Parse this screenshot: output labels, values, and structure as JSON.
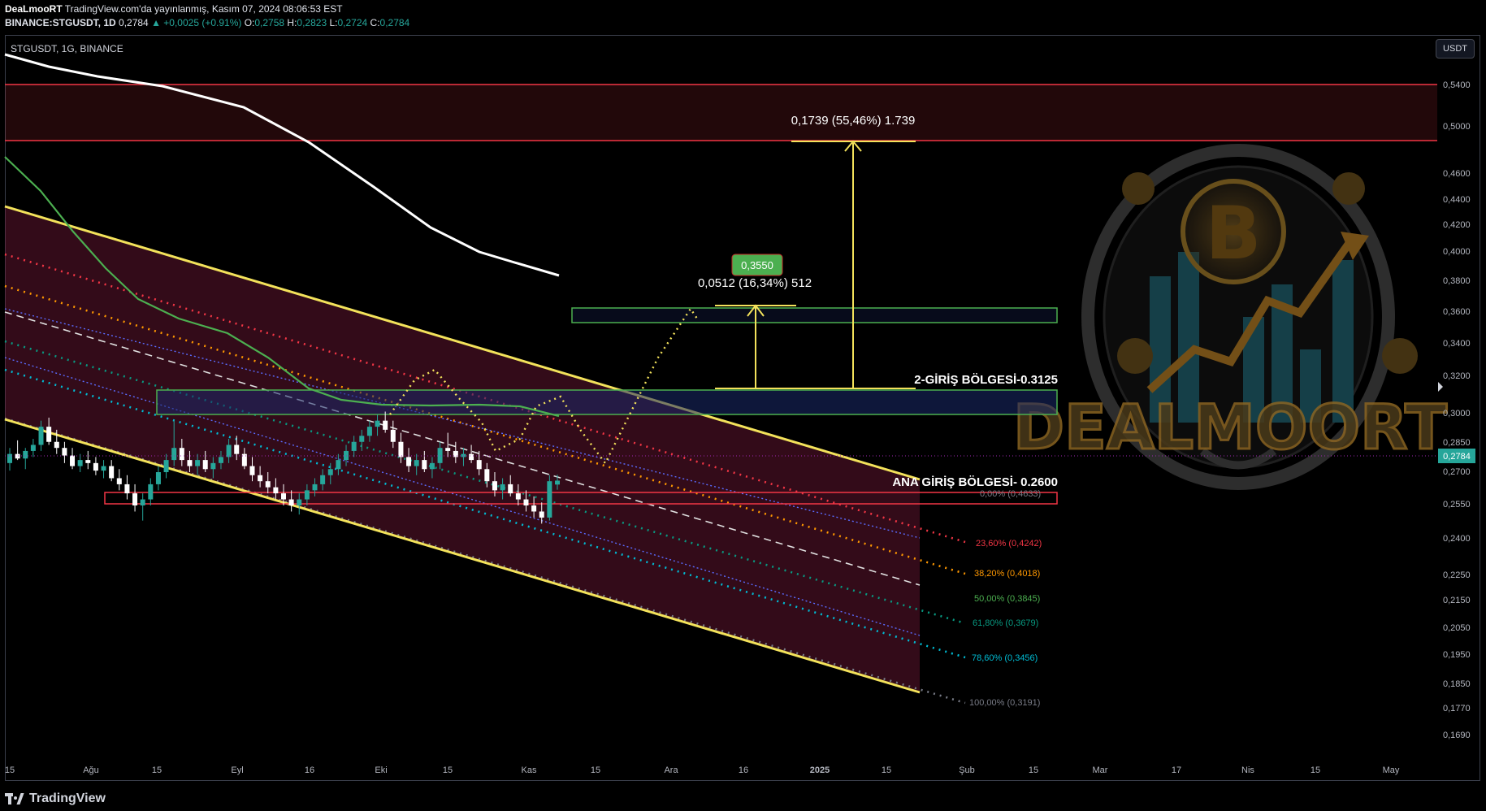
{
  "header": {
    "publisher": "DeaLmooRT",
    "published_text": "TradingView.com'da yayınlanmış, Kasım 07, 2024 08:06:53 EST",
    "symbol_line": "BINANCE:STGUSDT, 1D",
    "last": "0,2784",
    "change": "▲ +0,0025 (+0.91%)",
    "o_label": "O:",
    "o": "0,2758",
    "h_label": "H:",
    "h": "0,2823",
    "l_label": "L:",
    "l": "0,2724",
    "c_label": "C:",
    "c": "0,2784"
  },
  "pane_label": "STGUSDT, 1G, BINANCE",
  "currency_button": "USDT",
  "footer_logo": "TradingView",
  "watermark": "DEALMOORT",
  "colors": {
    "up": "#26a69a",
    "down": "#ffffff",
    "channel": "#f3e25b",
    "zone_red": "#f23645",
    "zone_green": "#4caf50"
  },
  "chart_data": {
    "type": "candlestick",
    "symbol": "STGUSDT",
    "timeframe": "1G",
    "y_axis_ticks": [
      "0,5400",
      "0,5000",
      "0,4600",
      "0,4400",
      "0,4200",
      "0,4000",
      "0,3800",
      "0,3600",
      "0,3400",
      "0,3200",
      "0,3000",
      "0,2850",
      "0,2700",
      "0,2550",
      "0,2400",
      "0,2250",
      "0,2150",
      "0,2050",
      "0,1950",
      "0,1850",
      "0,1770",
      "0,1690"
    ],
    "x_axis_ticks": [
      "15",
      "Ağu",
      "15",
      "Eyl",
      "16",
      "Eki",
      "15",
      "Kas",
      "15",
      "Ara",
      "16",
      "2025",
      "15",
      "Şub",
      "15",
      "Mar",
      "17",
      "Nis",
      "15",
      "May"
    ],
    "last_price_tag": "0,2784",
    "annotations": {
      "target_label": "0,1739 (55,46%) 1.739",
      "small_target_label": "0,0512 (16,34%) 512",
      "price_badge": "0,3550",
      "zone2_label": "2-GİRİŞ BÖLGESİ-0.3125",
      "main_zone_label": "ANA GİRİŞ BÖLGESİ- 0.2600"
    },
    "fib_levels": [
      {
        "label": "0,00% (0,4633)",
        "color": "#787b86"
      },
      {
        "label": "23,60% (0,4242)",
        "color": "#f23645"
      },
      {
        "label": "38,20% (0,4018)",
        "color": "#ff9800"
      },
      {
        "label": "50,00% (0,3845)",
        "color": "#4caf50"
      },
      {
        "label": "61,80% (0,3679)",
        "color": "#089981"
      },
      {
        "label": "78,60% (0,3456)",
        "color": "#00bcd4"
      },
      {
        "label": "100,00% (0,3191)",
        "color": "#787b86"
      }
    ],
    "candles": [
      [
        0.29,
        0.3,
        0.285,
        0.296
      ],
      [
        0.296,
        0.305,
        0.292,
        0.293
      ],
      [
        0.293,
        0.3,
        0.286,
        0.298
      ],
      [
        0.298,
        0.306,
        0.294,
        0.302
      ],
      [
        0.302,
        0.318,
        0.298,
        0.314
      ],
      [
        0.314,
        0.32,
        0.302,
        0.304
      ],
      [
        0.304,
        0.312,
        0.296,
        0.3
      ],
      [
        0.3,
        0.304,
        0.29,
        0.295
      ],
      [
        0.295,
        0.3,
        0.286,
        0.288
      ],
      [
        0.288,
        0.296,
        0.284,
        0.292
      ],
      [
        0.292,
        0.298,
        0.286,
        0.29
      ],
      [
        0.29,
        0.294,
        0.282,
        0.285
      ],
      [
        0.285,
        0.292,
        0.28,
        0.288
      ],
      [
        0.288,
        0.292,
        0.278,
        0.28
      ],
      [
        0.28,
        0.286,
        0.272,
        0.276
      ],
      [
        0.276,
        0.282,
        0.266,
        0.27
      ],
      [
        0.27,
        0.276,
        0.258,
        0.262
      ],
      [
        0.262,
        0.27,
        0.252,
        0.266
      ],
      [
        0.266,
        0.28,
        0.262,
        0.276
      ],
      [
        0.276,
        0.288,
        0.272,
        0.284
      ],
      [
        0.284,
        0.296,
        0.28,
        0.292
      ],
      [
        0.292,
        0.318,
        0.288,
        0.3
      ],
      [
        0.3,
        0.306,
        0.288,
        0.292
      ],
      [
        0.292,
        0.298,
        0.284,
        0.288
      ],
      [
        0.288,
        0.296,
        0.282,
        0.292
      ],
      [
        0.292,
        0.298,
        0.284,
        0.286
      ],
      [
        0.286,
        0.294,
        0.28,
        0.29
      ],
      [
        0.29,
        0.298,
        0.286,
        0.294
      ],
      [
        0.294,
        0.306,
        0.29,
        0.302
      ],
      [
        0.302,
        0.308,
        0.292,
        0.296
      ],
      [
        0.296,
        0.3,
        0.286,
        0.288
      ],
      [
        0.288,
        0.294,
        0.278,
        0.282
      ],
      [
        0.282,
        0.288,
        0.274,
        0.278
      ],
      [
        0.278,
        0.284,
        0.27,
        0.274
      ],
      [
        0.274,
        0.28,
        0.266,
        0.27
      ],
      [
        0.27,
        0.276,
        0.262,
        0.266
      ],
      [
        0.266,
        0.272,
        0.258,
        0.262
      ],
      [
        0.262,
        0.27,
        0.256,
        0.266
      ],
      [
        0.266,
        0.276,
        0.262,
        0.272
      ],
      [
        0.272,
        0.28,
        0.268,
        0.276
      ],
      [
        0.276,
        0.286,
        0.272,
        0.282
      ],
      [
        0.282,
        0.29,
        0.276,
        0.286
      ],
      [
        0.286,
        0.296,
        0.282,
        0.292
      ],
      [
        0.292,
        0.302,
        0.288,
        0.298
      ],
      [
        0.298,
        0.308,
        0.294,
        0.304
      ],
      [
        0.304,
        0.312,
        0.298,
        0.308
      ],
      [
        0.308,
        0.318,
        0.304,
        0.314
      ],
      [
        0.314,
        0.322,
        0.308,
        0.318
      ],
      [
        0.318,
        0.324,
        0.31,
        0.312
      ],
      [
        0.312,
        0.318,
        0.3,
        0.304
      ],
      [
        0.304,
        0.31,
        0.29,
        0.294
      ],
      [
        0.294,
        0.3,
        0.284,
        0.288
      ],
      [
        0.288,
        0.296,
        0.282,
        0.292
      ],
      [
        0.292,
        0.298,
        0.284,
        0.286
      ],
      [
        0.286,
        0.294,
        0.28,
        0.29
      ],
      [
        0.29,
        0.304,
        0.286,
        0.3
      ],
      [
        0.3,
        0.31,
        0.294,
        0.298
      ],
      [
        0.298,
        0.304,
        0.29,
        0.294
      ],
      [
        0.294,
        0.3,
        0.288,
        0.296
      ],
      [
        0.296,
        0.302,
        0.29,
        0.292
      ],
      [
        0.292,
        0.298,
        0.282,
        0.286
      ],
      [
        0.286,
        0.29,
        0.274,
        0.278
      ],
      [
        0.278,
        0.284,
        0.268,
        0.272
      ],
      [
        0.272,
        0.28,
        0.266,
        0.276
      ],
      [
        0.276,
        0.282,
        0.268,
        0.27
      ],
      [
        0.27,
        0.276,
        0.262,
        0.266
      ],
      [
        0.266,
        0.272,
        0.258,
        0.262
      ],
      [
        0.262,
        0.268,
        0.254,
        0.258
      ],
      [
        0.258,
        0.264,
        0.25,
        0.254
      ],
      [
        0.254,
        0.282,
        0.252,
        0.278
      ],
      [
        0.2758,
        0.2823,
        0.2724,
        0.2784
      ]
    ]
  }
}
